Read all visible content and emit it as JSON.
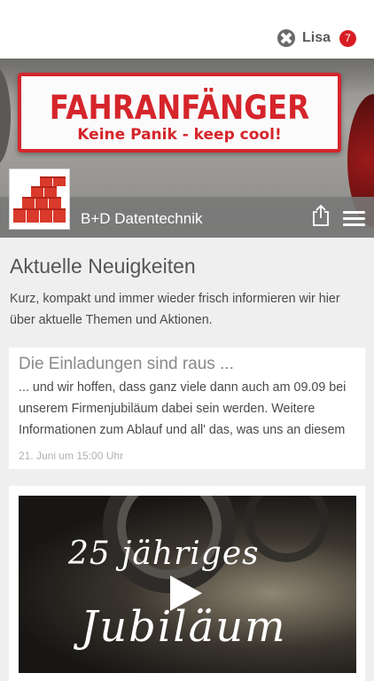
{
  "header": {
    "user_name": "Lisa",
    "notification_count": "7",
    "user_icon": "user-switch-icon"
  },
  "hero": {
    "sticker_title": "FAHRANFÄNGER",
    "sticker_subtitle": "Keine Panik - keep cool!"
  },
  "brand": {
    "name": "B+D Datentechnik",
    "share_icon": "share-icon",
    "menu_icon": "hamburger-menu-icon"
  },
  "main": {
    "title": "Aktuelle Neuigkeiten",
    "intro": "Kurz, kompakt und immer wieder frisch informieren wir hier über aktuelle Themen und Aktionen."
  },
  "news": [
    {
      "title": "Die Einladungen sind raus ...",
      "body": "... und wir hoffen, dass ganz viele dann auch am 09.09 bei unserem Firmenjubiläum dabei sein werden. Weitere Informationen zum Ablauf und all' das, was uns an diesem",
      "date": "21. Juni um 15:00 Uhr"
    }
  ],
  "video": {
    "line1": "25 jähriges",
    "line2": "Jubiläum"
  },
  "colors": {
    "accent": "#d71d23",
    "brand_bar": "#787878",
    "background": "#efefef"
  }
}
